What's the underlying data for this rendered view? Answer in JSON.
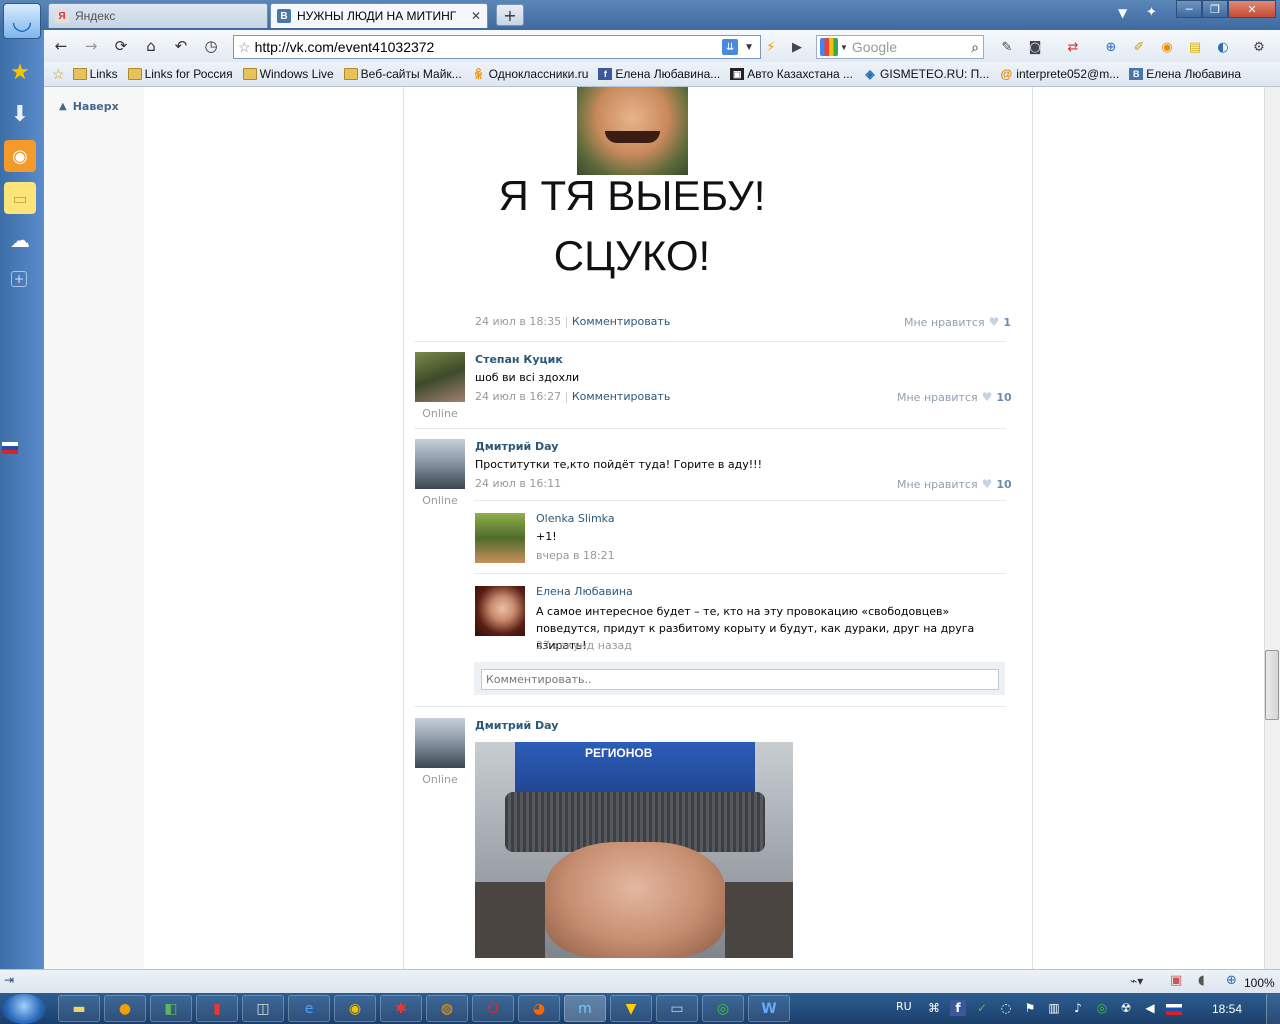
{
  "browser": {
    "tabs": [
      {
        "label": "Яндекс",
        "favicon": "Я"
      },
      {
        "label": "НУЖНЫ ЛЮДИ НА МИТИНГ",
        "favicon": "В"
      }
    ],
    "new_tab": "+",
    "url": "http://vk.com/event41032372",
    "search_placeholder": "Google",
    "zoom": "100%"
  },
  "bookmarks": [
    {
      "label": "Links",
      "icon": "folder-icon"
    },
    {
      "label": "Links for Россия",
      "icon": "folder-icon"
    },
    {
      "label": "Windows Live",
      "icon": "folder-icon"
    },
    {
      "label": "Веб-сайты Майк...",
      "icon": "folder-icon"
    },
    {
      "label": "Одноклассники.ru",
      "icon": "odnoklassniki-icon"
    },
    {
      "label": "Елена Любавина...",
      "icon": "facebook-icon"
    },
    {
      "label": "Авто Казахстана ...",
      "icon": "car-icon"
    },
    {
      "label": "GISMETEO.RU: П...",
      "icon": "drop-icon"
    },
    {
      "label": "interprete052@m...",
      "icon": "at-icon"
    },
    {
      "label": "Елена Любавина",
      "icon": "vk-icon"
    }
  ],
  "page": {
    "back_to_top": "Наверх",
    "meme_text_1": "Я ТЯ ВЫЕБУ!",
    "meme_text_2": "СЦУКО!",
    "post0": {
      "date": "24 июл в 18:35",
      "comment": "Комментировать",
      "like_label": "Мне нравится",
      "likes": "1"
    },
    "post1": {
      "author": "Степан Куцик",
      "text": "шоб ви всі здохли",
      "date": "24 июл в 16:27",
      "comment": "Комментировать",
      "like_label": "Мне нравится",
      "likes": "10",
      "online": "Online"
    },
    "post2": {
      "author": "Дмитрий Day",
      "text": "Проститутки те,кто пойдёт туда! Горите в аду!!!",
      "date": "24 июл в 16:11",
      "like_label": "Мне нравится",
      "likes": "10",
      "online": "Online",
      "replies": [
        {
          "author": "Olenka Slimka",
          "text": "+1!",
          "date": "вчера в 18:21"
        },
        {
          "author": "Елена Любавина",
          "text": "А самое интересное будет – те, кто на эту провокацию «свободовцев» поведутся, придут к разбитому корыту и будут, как дураки, друг на друга взирать!",
          "date": "27 секунд назад"
        }
      ],
      "comment_placeholder": "Комментировать.."
    },
    "post3": {
      "author": "Дмитрий Day",
      "online": "Online",
      "hat_text": "РЕГИОНОВ"
    }
  },
  "taskbar": {
    "lang": "RU",
    "time": "18:54"
  },
  "colors": {
    "vk_link": "#2b587a",
    "meta": "#999999",
    "taskbar": "#1c3f6a"
  }
}
